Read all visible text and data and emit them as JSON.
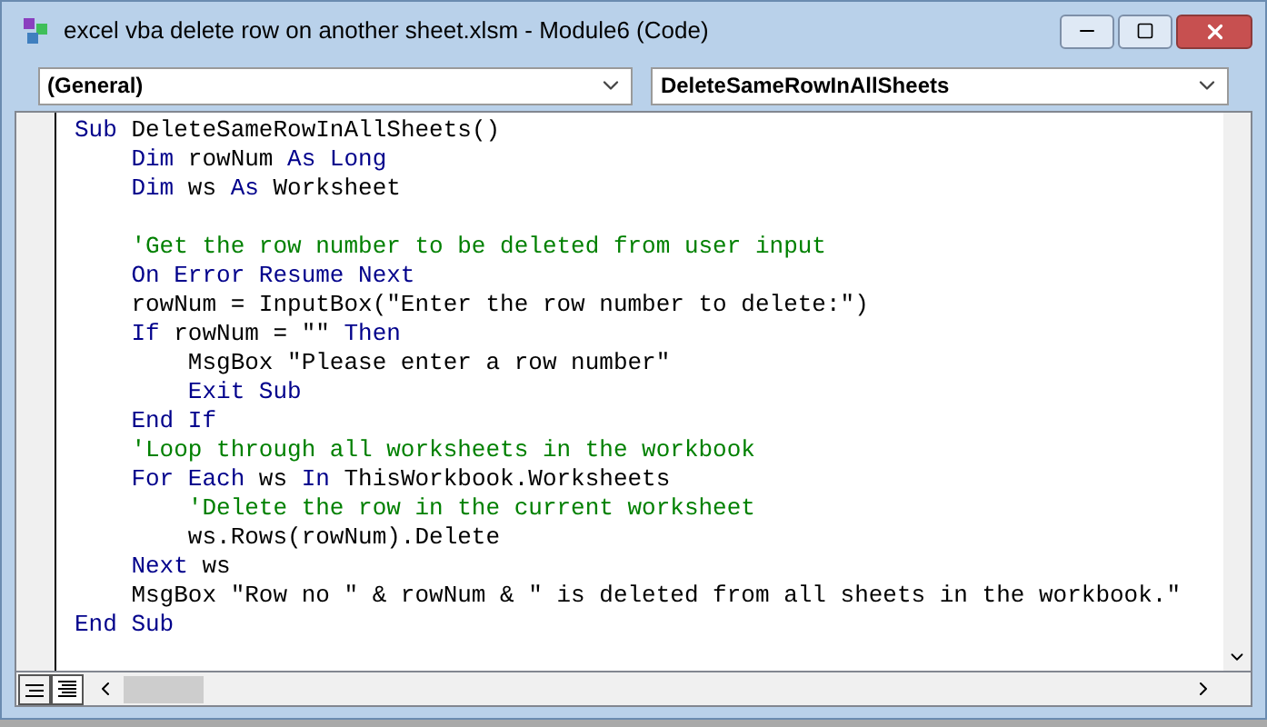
{
  "window": {
    "title": "excel vba delete row on another sheet.xlsm - Module6 (Code)"
  },
  "object_dropdown": {
    "value": "(General)"
  },
  "procedure_dropdown": {
    "value": "DeleteSameRowInAllSheets"
  },
  "code_lines": [
    {
      "kind": "code",
      "segments": [
        {
          "text": "Sub ",
          "kind": "keyword"
        },
        {
          "text": "DeleteSameRowInAllSheets()",
          "kind": "plain"
        }
      ]
    },
    {
      "kind": "code",
      "segments": [
        {
          "text": "    Dim ",
          "kind": "keyword"
        },
        {
          "text": "rowNum ",
          "kind": "plain"
        },
        {
          "text": "As Long",
          "kind": "keyword"
        }
      ]
    },
    {
      "kind": "code",
      "segments": [
        {
          "text": "    Dim ",
          "kind": "keyword"
        },
        {
          "text": "ws ",
          "kind": "plain"
        },
        {
          "text": "As ",
          "kind": "keyword"
        },
        {
          "text": "Worksheet",
          "kind": "plain"
        }
      ]
    },
    {
      "kind": "blank"
    },
    {
      "kind": "code",
      "segments": [
        {
          "text": "    'Get the row number to be deleted from user input",
          "kind": "comment"
        }
      ]
    },
    {
      "kind": "code",
      "segments": [
        {
          "text": "    On Error Resume Next",
          "kind": "keyword"
        }
      ]
    },
    {
      "kind": "code",
      "segments": [
        {
          "text": "    rowNum = InputBox(\"Enter the row number to delete:\")",
          "kind": "plain"
        }
      ]
    },
    {
      "kind": "code",
      "segments": [
        {
          "text": "    If ",
          "kind": "keyword"
        },
        {
          "text": "rowNum = \"\" ",
          "kind": "plain"
        },
        {
          "text": "Then",
          "kind": "keyword"
        }
      ]
    },
    {
      "kind": "code",
      "segments": [
        {
          "text": "        MsgBox \"Please enter a row number\"",
          "kind": "plain"
        }
      ]
    },
    {
      "kind": "code",
      "segments": [
        {
          "text": "        Exit Sub",
          "kind": "keyword"
        }
      ]
    },
    {
      "kind": "code",
      "segments": [
        {
          "text": "    End If",
          "kind": "keyword"
        }
      ]
    },
    {
      "kind": "code",
      "segments": [
        {
          "text": "    'Loop through all worksheets in the workbook",
          "kind": "comment"
        }
      ]
    },
    {
      "kind": "code",
      "segments": [
        {
          "text": "    For Each ",
          "kind": "keyword"
        },
        {
          "text": "ws ",
          "kind": "plain"
        },
        {
          "text": "In ",
          "kind": "keyword"
        },
        {
          "text": "ThisWorkbook.Worksheets",
          "kind": "plain"
        }
      ]
    },
    {
      "kind": "code",
      "segments": [
        {
          "text": "        'Delete the row in the current worksheet",
          "kind": "comment"
        }
      ]
    },
    {
      "kind": "code",
      "segments": [
        {
          "text": "        ws.Rows(rowNum).Delete",
          "kind": "plain"
        }
      ]
    },
    {
      "kind": "code",
      "segments": [
        {
          "text": "    Next ",
          "kind": "keyword"
        },
        {
          "text": "ws",
          "kind": "plain"
        }
      ]
    },
    {
      "kind": "code",
      "segments": [
        {
          "text": "    MsgBox \"Row no \" & rowNum & \" is deleted from all sheets in the workbook.\"",
          "kind": "plain"
        }
      ]
    },
    {
      "kind": "code",
      "segments": [
        {
          "text": "End Sub",
          "kind": "keyword"
        }
      ]
    }
  ]
}
